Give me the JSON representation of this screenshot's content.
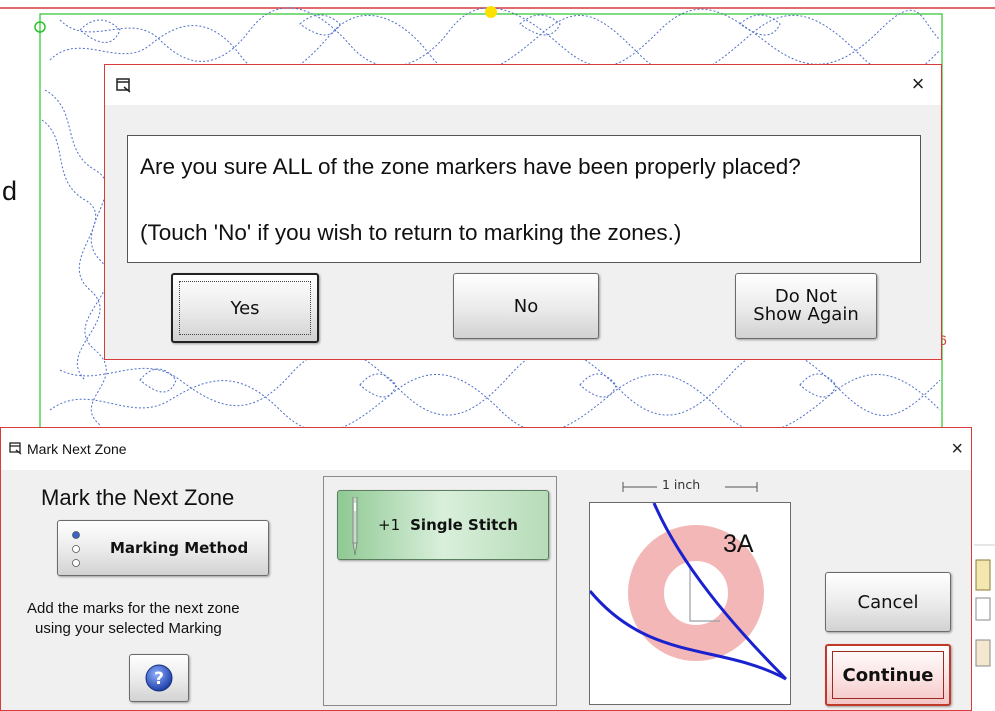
{
  "background": {
    "stray_text": "d"
  },
  "confirm_dialog": {
    "title_icon": "window-icon",
    "close_glyph": "×",
    "message_line1": "Are you sure ALL of the zone markers have been properly placed?",
    "message_line2": "(Touch 'No' if you wish to return to marking the zones.)",
    "buttons": {
      "yes": "Yes",
      "no": "No",
      "do_not_show_line1": "Do Not",
      "do_not_show_line2": "Show Again"
    }
  },
  "mark_panel": {
    "title": "Mark Next Zone",
    "close_glyph": "×",
    "heading": "Mark the Next Zone",
    "marking_method_label": "Marking Method",
    "instructions_line1": "Add the marks for the next zone",
    "instructions_line2": "using your selected Marking",
    "help_glyph": "?",
    "stitch_button": {
      "plus_label": "+1",
      "label": "Single Stitch"
    },
    "ruler_label": "1 inch",
    "zone_label": "3A",
    "cancel_label": "Cancel",
    "continue_label": "Continue"
  },
  "colors": {
    "frame_red": "#d93a3a",
    "stitch_blue": "#1a22d0",
    "zone_ring_pink": "#f4b7b7",
    "stitch_green": "#8fc993",
    "continue_pink": "#f4c6c6"
  }
}
